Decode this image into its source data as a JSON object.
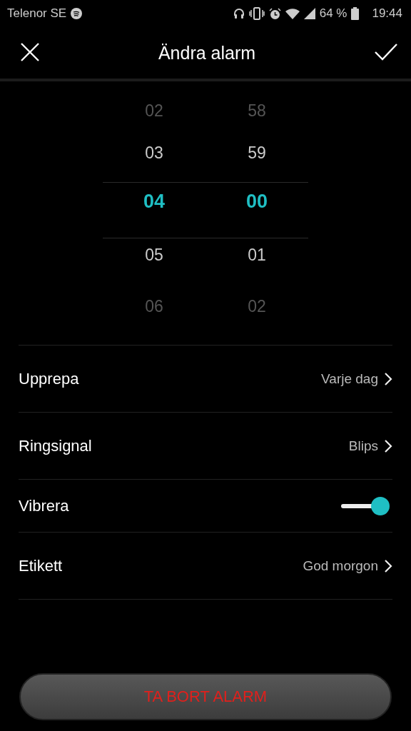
{
  "status_bar": {
    "carrier": "Telenor SE",
    "battery": "64 %",
    "time": "19:44"
  },
  "header": {
    "title": "Ändra alarm"
  },
  "time_picker": {
    "columns": [
      {
        "items": [
          {
            "value": "02",
            "selected": false
          },
          {
            "value": "03",
            "selected": false
          },
          {
            "value": "04",
            "selected": true
          },
          {
            "value": "05",
            "selected": false
          },
          {
            "value": "06",
            "selected": false
          }
        ]
      },
      {
        "items": [
          {
            "value": "58",
            "selected": false
          },
          {
            "value": "59",
            "selected": false
          },
          {
            "value": "00",
            "selected": true
          },
          {
            "value": "01",
            "selected": false
          },
          {
            "value": "02",
            "selected": false
          }
        ]
      }
    ]
  },
  "settings": [
    {
      "kind": "link",
      "label": "Upprepa",
      "value": "Varje dag"
    },
    {
      "kind": "link",
      "label": "Ringsignal",
      "value": "Blips"
    },
    {
      "kind": "toggle",
      "label": "Vibrera",
      "on": true
    },
    {
      "kind": "link",
      "label": "Etikett",
      "value": "God morgon"
    }
  ],
  "delete_button": {
    "label": "TA BORT ALARM"
  }
}
